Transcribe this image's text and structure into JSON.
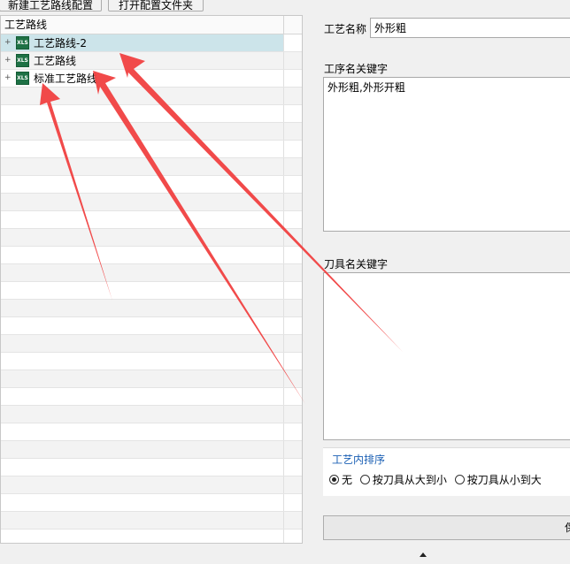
{
  "toolbar": {
    "new_route_config": "新建工艺路线配置",
    "open_config_folder": "打开配置文件夹"
  },
  "tree": {
    "header": "工艺路线",
    "nodes": [
      {
        "label": "工艺路线-2",
        "icon": "excel-file-icon",
        "expander": "+"
      },
      {
        "label": "工艺路线",
        "icon": "excel-file-icon",
        "expander": "+"
      },
      {
        "label": "标准工艺路线",
        "icon": "excel-file-icon",
        "expander": "+"
      }
    ]
  },
  "form": {
    "route_name_label": "工艺名称",
    "route_name_value": "外形粗",
    "process_keywords_label": "工序名关键字",
    "process_keywords_value": "外形粗,外形开粗",
    "tool_keywords_label": "刀具名关键字",
    "tool_keywords_value": "",
    "sort_group_title": "工艺内排序",
    "sort_options": [
      "无",
      "按刀具从大到小",
      "按刀具从小到大"
    ],
    "selected_sort": "无",
    "save_label": "保"
  },
  "annotation": {
    "arrow_color": "#f04040",
    "arrow_count": 3
  }
}
